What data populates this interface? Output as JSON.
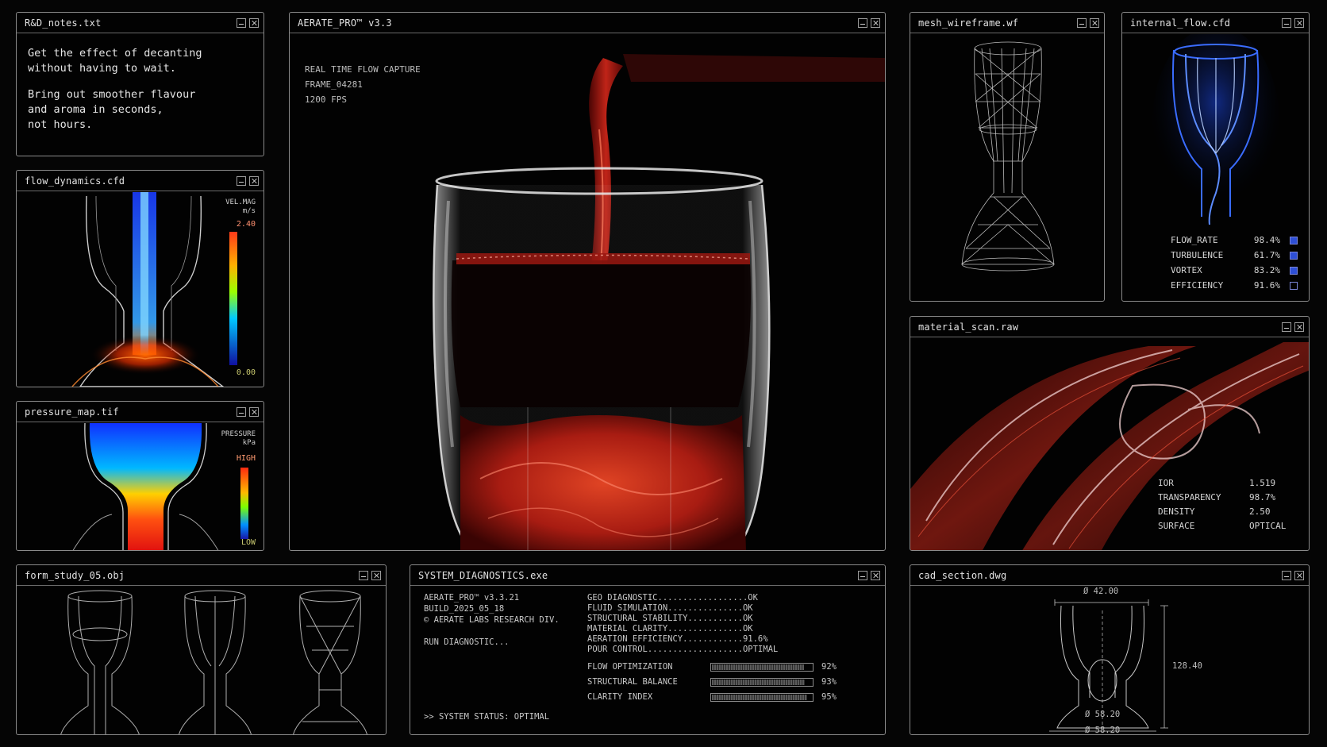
{
  "windows": {
    "notes": {
      "title": "R&D_notes.txt",
      "lines": [
        "Get the effect of decanting\nwithout having to wait.",
        "Bring out smoother flavour\nand aroma in seconds,\nnot hours."
      ]
    },
    "flow_dynamics": {
      "title": "flow_dynamics.cfd",
      "legend_label": "VEL.MAG",
      "legend_unit": "m/s",
      "legend_max": "2.40",
      "legend_min": "0.00"
    },
    "pressure_map": {
      "title": "pressure_map.tif",
      "legend_label": "PRESSURE",
      "legend_unit": "kPa",
      "legend_high": "HIGH",
      "legend_low": "LOW"
    },
    "main": {
      "title": "AERATE_PRO™ v3.3",
      "capture_lines": [
        "REAL TIME FLOW CAPTURE",
        "FRAME_04281",
        "1200 FPS"
      ]
    },
    "mesh": {
      "title": "mesh_wireframe.wf"
    },
    "internal_flow": {
      "title": "internal_flow.cfd",
      "metrics": [
        {
          "name": "FLOW_RATE",
          "value": "98.4%",
          "active": true
        },
        {
          "name": "TURBULENCE",
          "value": "61.7%",
          "active": true
        },
        {
          "name": "VORTEX",
          "value": "83.2%",
          "active": true
        },
        {
          "name": "EFFICIENCY",
          "value": "91.6%",
          "active": false
        }
      ]
    },
    "material": {
      "title": "material_scan.raw",
      "props": [
        {
          "name": "IOR",
          "value": "1.519"
        },
        {
          "name": "TRANSPARENCY",
          "value": "98.7%"
        },
        {
          "name": "DENSITY",
          "value": "2.50"
        },
        {
          "name": "SURFACE",
          "value": "OPTICAL"
        }
      ]
    },
    "form_study": {
      "title": "form_study_05.obj"
    },
    "diagnostics": {
      "title": "SYSTEM_DIAGNOSTICS.exe",
      "info_lines": [
        "AERATE_PRO™ v3.3.21",
        "BUILD_2025_05_18",
        "© AERATE LABS RESEARCH DIV."
      ],
      "run_label": "RUN DIAGNOSTIC...",
      "checks": [
        "GEO DIAGNOSTIC..................OK",
        "FLUID SIMULATION...............OK",
        "STRUCTURAL STABILITY...........OK",
        "MATERIAL CLARITY...............OK",
        "AERATION EFFICIENCY............91.6%",
        "POUR CONTROL...................OPTIMAL"
      ],
      "bars": [
        {
          "name": "FLOW OPTIMIZATION",
          "pct_label": "92%",
          "fraction": 0.92
        },
        {
          "name": "STRUCTURAL BALANCE",
          "pct_label": "93%",
          "fraction": 0.93
        },
        {
          "name": "CLARITY INDEX",
          "pct_label": "95%",
          "fraction": 0.95
        }
      ],
      "status": ">> SYSTEM STATUS: OPTIMAL"
    },
    "cad": {
      "title": "cad_section.dwg",
      "dim_top": "Ø 42.00",
      "dim_height": "128.40",
      "dim_base": "Ø 58.20",
      "dim_base2": "Ø 58.20"
    }
  },
  "colors": {
    "wine": "#c2261c",
    "flow_blue": "#2f5cff",
    "border": "#8a8a8a"
  }
}
